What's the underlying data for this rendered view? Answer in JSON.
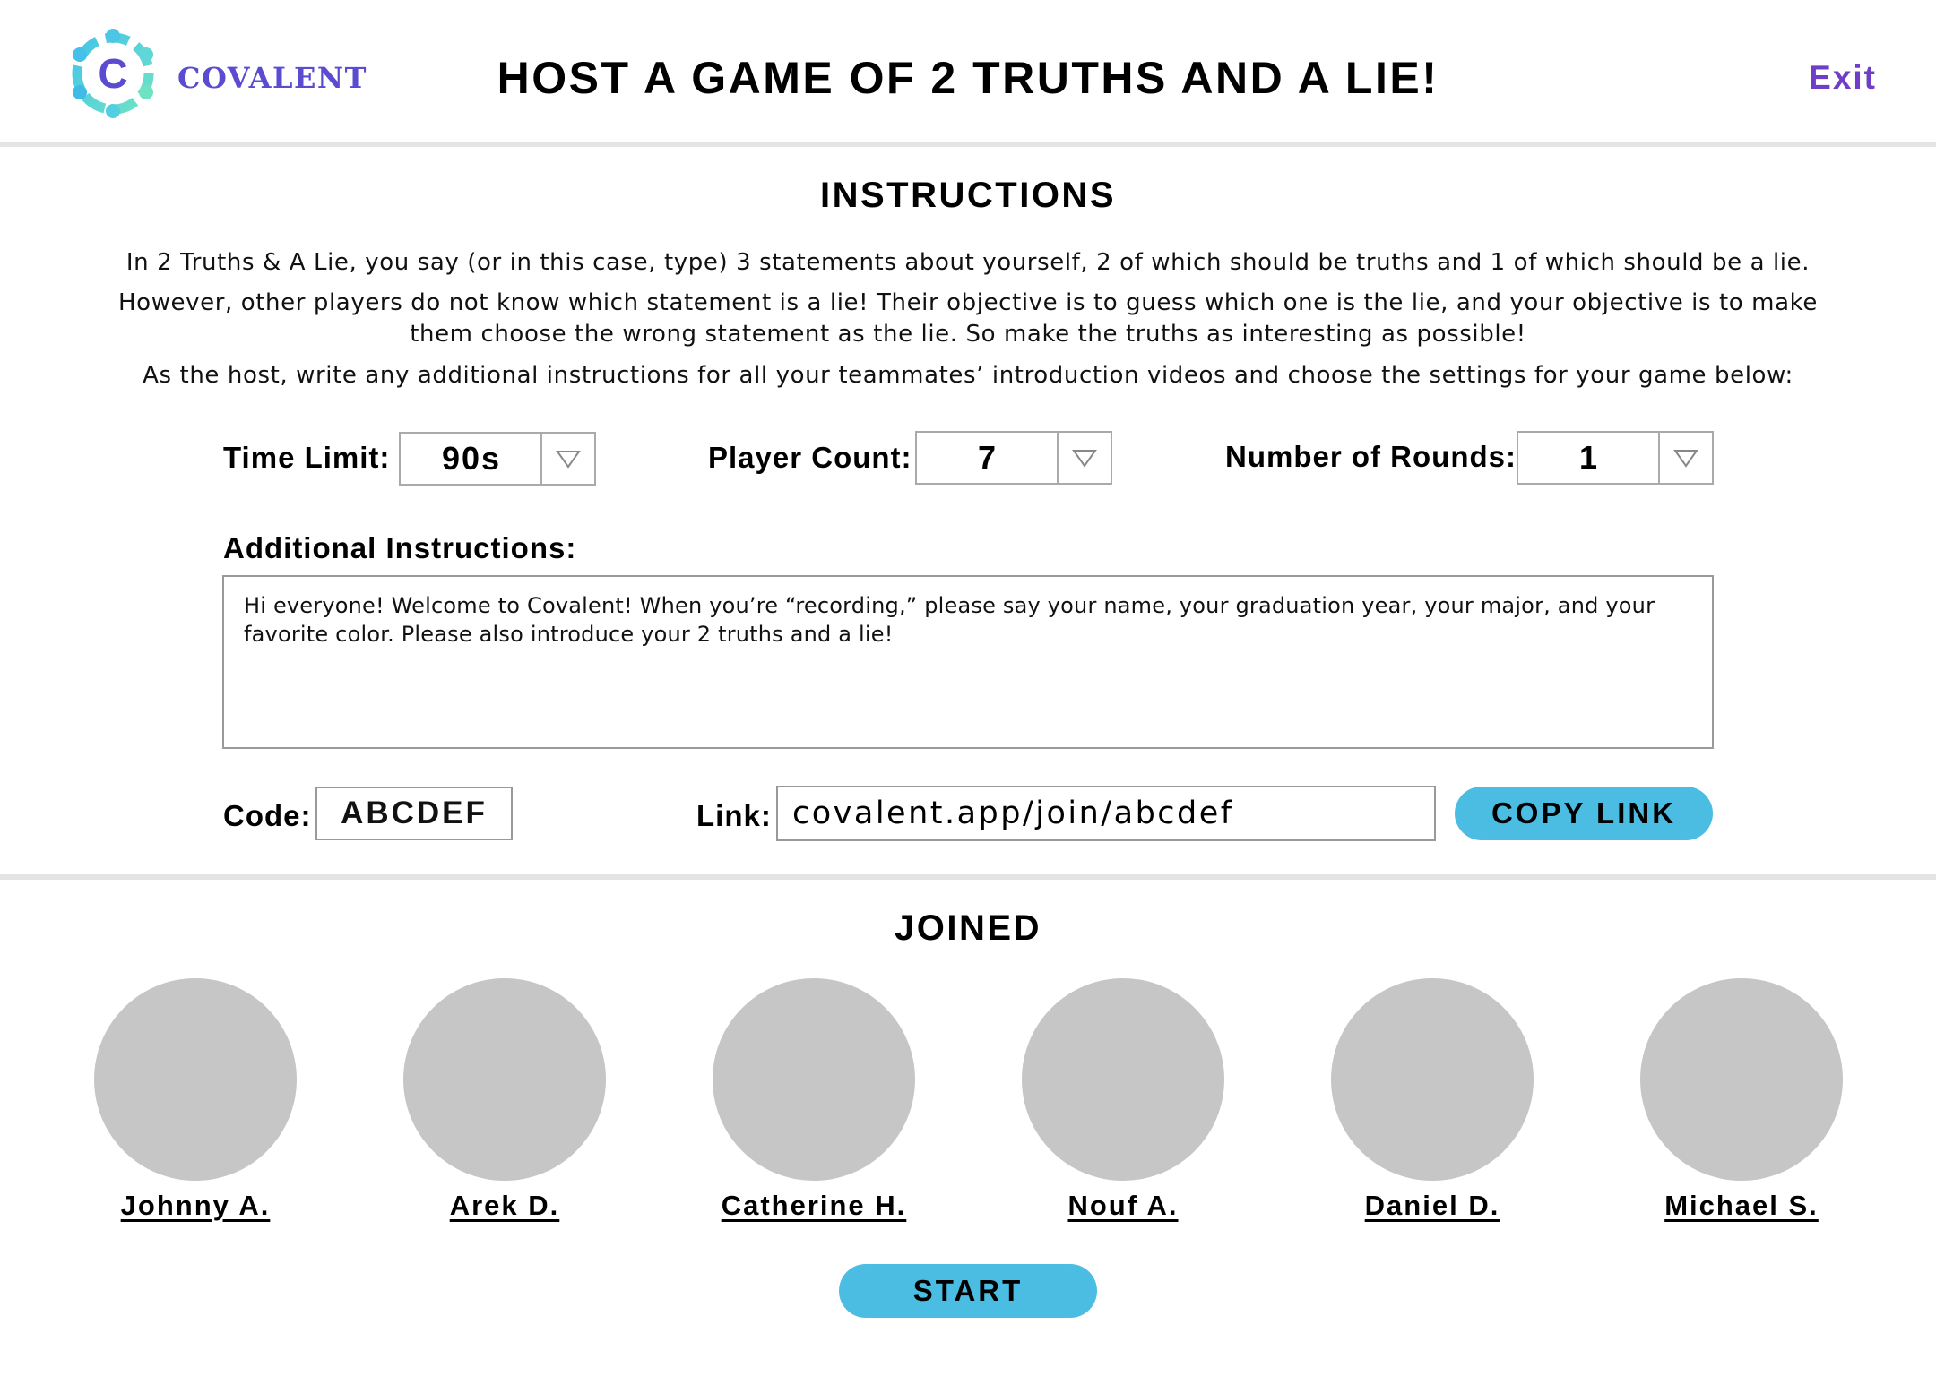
{
  "header": {
    "brand": "COVALENT",
    "logo_letter": "C",
    "title": "HOST A GAME OF 2 TRUTHS AND A LIE!",
    "exit_label": "Exit"
  },
  "instructions": {
    "heading": "INSTRUCTIONS",
    "paragraph_1": "In 2 Truths & A Lie, you say (or in this case, type) 3 statements about yourself, 2 of which should be truths and 1 of which should be a lie.",
    "paragraph_2": "However, other players do not know which statement is a lie! Their objective is to guess which one is the lie, and your objective is to make them choose the wrong statement as the lie. So make the truths as interesting as possible!",
    "paragraph_3": "As the host, write any additional instructions for all your teammates’ introduction videos and choose the settings for your game below:"
  },
  "settings": {
    "time_limit": {
      "label": "Time Limit:",
      "value": "90s"
    },
    "player_count": {
      "label": "Player Count:",
      "value": "7"
    },
    "rounds": {
      "label": "Number of Rounds:",
      "value": "1"
    }
  },
  "additional": {
    "label": "Additional Instructions:",
    "text": "Hi everyone! Welcome to Covalent! When you’re “recording,” please say your name, your graduation year, your major, and your favorite color. Please also introduce your 2 truths and a lie!"
  },
  "share": {
    "code_label": "Code:",
    "code": "ABCDEF",
    "link_label": "Link:",
    "link": "covalent.app/join/abcdef",
    "copy_label": "COPY LINK"
  },
  "joined": {
    "heading": "JOINED",
    "players": [
      "Johnny A.",
      "Arek D.",
      "Catherine H.",
      "Nouf A.",
      "Daniel D.",
      "Michael S."
    ]
  },
  "start_label": "START",
  "colors": {
    "accent_blue": "#4bbde3",
    "brand_purple": "#5a4bd1",
    "exit_purple": "#6e3fc6",
    "avatar_gray": "#c6c6c6"
  }
}
